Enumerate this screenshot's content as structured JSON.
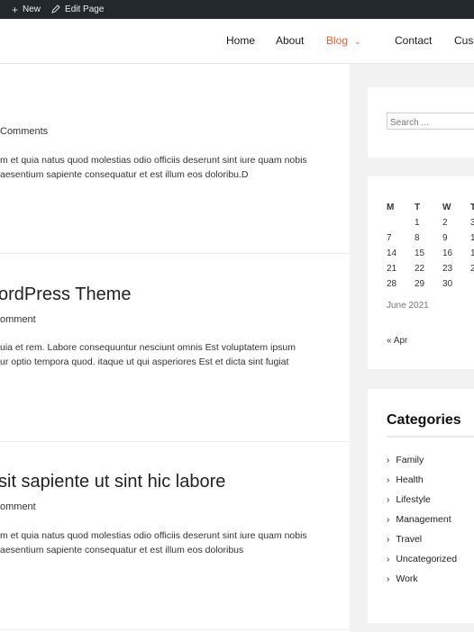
{
  "adminbar": {
    "new_label": "New",
    "edit_label": "Edit Page"
  },
  "nav": {
    "items": [
      {
        "label": "Home"
      },
      {
        "label": "About"
      },
      {
        "label": "Blog"
      },
      {
        "label": "Contact"
      },
      {
        "label": "Cus"
      }
    ]
  },
  "posts": [
    {
      "title": "",
      "meta": "Comments",
      "excerpt": [
        "m et quia natus quod molestias odio officiis deserunt sint iure quam nobis",
        "aesentium sapiente consequatur et est illum eos doloribu.D"
      ]
    },
    {
      "title": "ordPress Theme",
      "meta": "omment",
      "excerpt": [
        "uia et rem. Labore consequuntur nesciunt omnis Est voluptatem ipsum",
        "ur optio tempora quod. itaque ut qui asperiores Est et dicta sint fugiat"
      ]
    },
    {
      "title": "sit sapiente ut sint hic labore",
      "meta": "omment",
      "excerpt": [
        "m et quia natus quod molestias odio officiis deserunt sint iure quam nobis",
        "aesentium sapiente consequatur et est illum eos doloribus"
      ]
    }
  ],
  "search": {
    "placeholder": "Search ..."
  },
  "calendar": {
    "headers": [
      "M",
      "T",
      "W",
      "T"
    ],
    "rows": [
      [
        "",
        "1",
        "2",
        "3"
      ],
      [
        "7",
        "8",
        "9",
        "1"
      ],
      [
        "14",
        "15",
        "16",
        "1"
      ],
      [
        "21",
        "22",
        "23",
        "2"
      ],
      [
        "28",
        "29",
        "30",
        ""
      ]
    ],
    "caption": "June 2021",
    "prev": "« Apr"
  },
  "categories": {
    "title": "Categories",
    "items": [
      "Family",
      "Health",
      "Lifestyle",
      "Management",
      "Travel",
      "Uncategorized",
      "Work"
    ]
  }
}
